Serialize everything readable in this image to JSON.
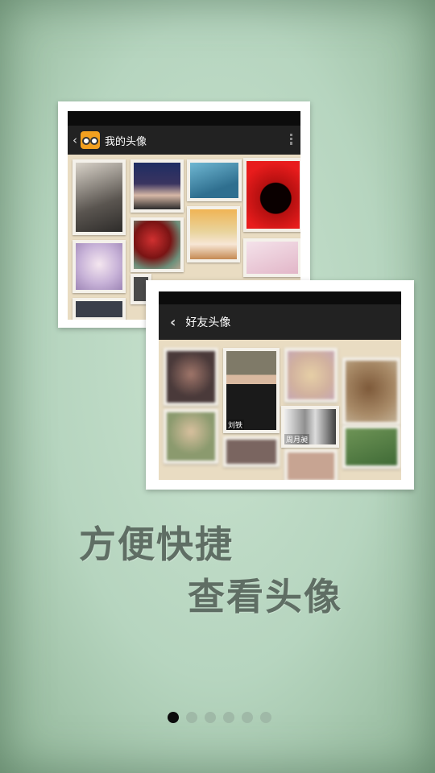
{
  "cards": {
    "my_avatars": {
      "title": "我的头像",
      "back_glyph": "‹"
    },
    "friend_avatars": {
      "title": "好友头像",
      "back_glyph": "‹",
      "labels": {
        "tile_a": "刘铁",
        "tile_b": "周月昶"
      }
    }
  },
  "headline": {
    "line1": "方便快捷",
    "line2": "查看头像"
  },
  "pager": {
    "pages": 6,
    "active_index": 0
  }
}
